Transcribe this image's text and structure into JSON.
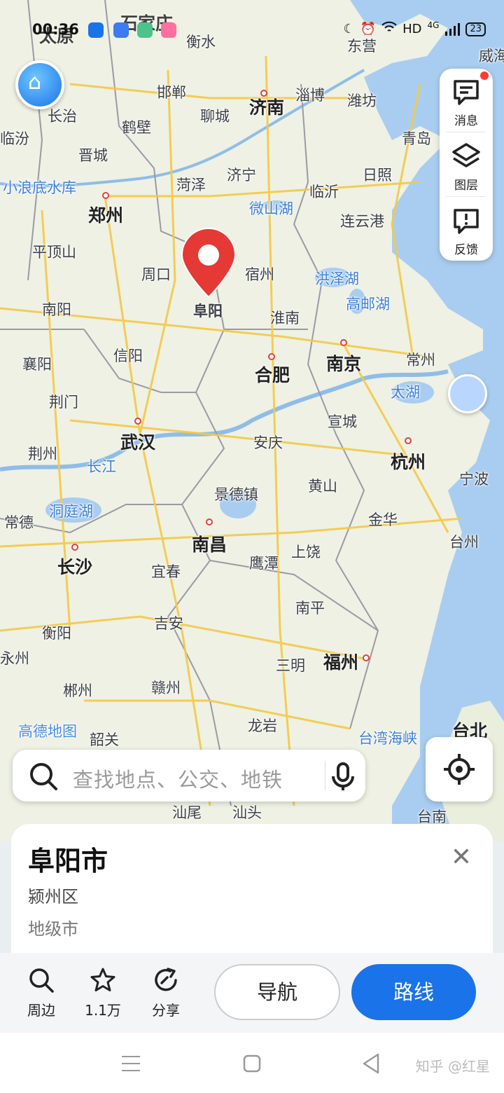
{
  "status_bar": {
    "time": "00:36",
    "network": "HD",
    "signal": "4G",
    "battery": "23"
  },
  "map": {
    "selected_city_label": "阜阳",
    "cities_major": [
      {
        "name": "郑州"
      },
      {
        "name": "济南"
      },
      {
        "name": "合肥"
      },
      {
        "name": "南京"
      },
      {
        "name": "武汉"
      },
      {
        "name": "杭州"
      },
      {
        "name": "南昌"
      },
      {
        "name": "长沙"
      },
      {
        "name": "福州"
      },
      {
        "name": "太原"
      },
      {
        "name": "石家庄"
      }
    ],
    "cities_minor": [
      {
        "name": "衡水"
      },
      {
        "name": "东营"
      },
      {
        "name": "威海"
      },
      {
        "name": "邯郸"
      },
      {
        "name": "淄博"
      },
      {
        "name": "潍坊"
      },
      {
        "name": "长治"
      },
      {
        "name": "聊城"
      },
      {
        "name": "临汾"
      },
      {
        "name": "鹤壁"
      },
      {
        "name": "青岛"
      },
      {
        "name": "晋城"
      },
      {
        "name": "菏泽"
      },
      {
        "name": "济宁"
      },
      {
        "name": "日照"
      },
      {
        "name": "临沂"
      },
      {
        "name": "连云港"
      },
      {
        "name": "平顶山"
      },
      {
        "name": "周口"
      },
      {
        "name": "宿州"
      },
      {
        "name": "南阳"
      },
      {
        "name": "淮南"
      },
      {
        "name": "信阳"
      },
      {
        "name": "襄阳"
      },
      {
        "name": "常州"
      },
      {
        "name": "荆门"
      },
      {
        "name": "宣城"
      },
      {
        "name": "安庆"
      },
      {
        "name": "荆州"
      },
      {
        "name": "宁波"
      },
      {
        "name": "黄山"
      },
      {
        "name": "景德镇"
      },
      {
        "name": "金华"
      },
      {
        "name": "常德"
      },
      {
        "name": "台州"
      },
      {
        "name": "上饶"
      },
      {
        "name": "鹰潭"
      },
      {
        "name": "宜春"
      },
      {
        "name": "衡阳"
      },
      {
        "name": "吉安"
      },
      {
        "name": "南平"
      },
      {
        "name": "永州"
      },
      {
        "name": "三明"
      },
      {
        "name": "郴州"
      },
      {
        "name": "赣州"
      },
      {
        "name": "龙岩"
      },
      {
        "name": "台北"
      },
      {
        "name": "韶关"
      },
      {
        "name": "汕尾"
      },
      {
        "name": "汕头"
      },
      {
        "name": "台南"
      }
    ],
    "water_labels": [
      {
        "name": "小浪底水库"
      },
      {
        "name": "微山湖"
      },
      {
        "name": "洪泽湖"
      },
      {
        "name": "高邮湖"
      },
      {
        "name": "太湖"
      },
      {
        "name": "长江"
      },
      {
        "name": "洞庭湖"
      },
      {
        "name": "台湾海峡"
      }
    ],
    "logo": "高德地图"
  },
  "side_panel": {
    "messages_label": "消息",
    "layers_label": "图层",
    "feedback_label": "反馈"
  },
  "search": {
    "placeholder": "查找地点、公交、地铁"
  },
  "info_card": {
    "title": "阜阳市",
    "district": "颍州区",
    "level": "地级市"
  },
  "actions": {
    "nearby_label": "周边",
    "favorite_count": "1.1万",
    "share_label": "分享",
    "navigate_label": "导航",
    "route_label": "路线"
  },
  "watermark": "知乎 @红星",
  "colors": {
    "accent": "#1a73e8",
    "marker": "#e53935",
    "sea": "#a9cdf0"
  }
}
